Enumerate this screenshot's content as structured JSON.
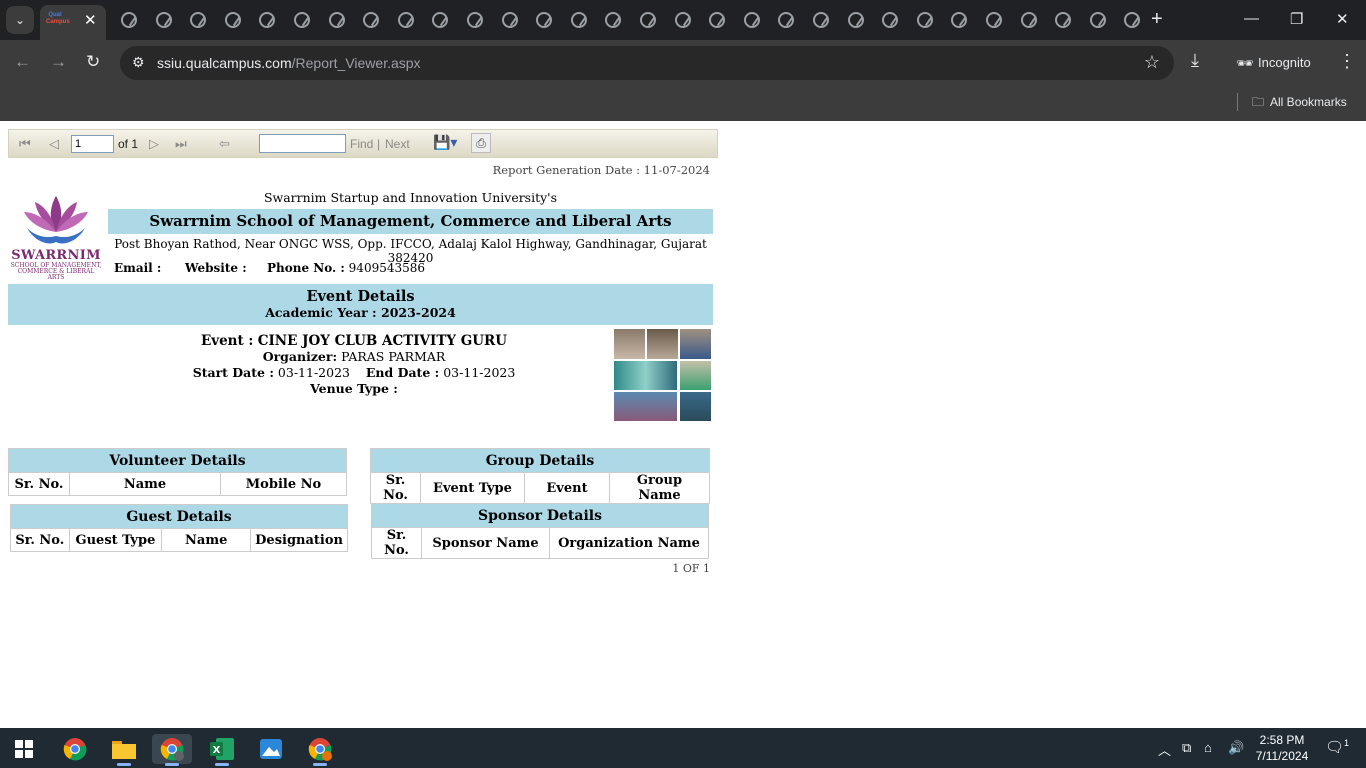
{
  "browser": {
    "tab_favicon_top": "Qual",
    "tab_favicon_bottom": "Campus",
    "url_host": "ssiu.qualcampus.com",
    "url_path": "/Report_Viewer.aspx",
    "incognito_label": "Incognito",
    "bookmarks_label": "All Bookmarks"
  },
  "viewer": {
    "page_value": "1",
    "of_pages": "of 1",
    "find_label": "Find",
    "find_sep": "|",
    "next_label": "Next"
  },
  "report": {
    "generation_date": "Report Generation Date : 11-07-2024",
    "logo_text": "SWARRNIM",
    "logo_sub1": "SCHOOL OF MANAGEMENT,",
    "logo_sub2": "COMMERCE & LIBERAL ARTS",
    "university": "Swarrnim Startup and Innovation University's",
    "school": "Swarrnim School of Management, Commerce and Liberal Arts",
    "address": "Post Bhoyan Rathod, Near ONGC WSS, Opp. IFCCO, Adalaj Kalol Highway, Gandhinagar, Gujarat 382420",
    "email_label": "Email :",
    "website_label": "Website :",
    "phone_label": "Phone No. :",
    "phone_value": "9409543586",
    "event_details_title": "Event Details",
    "academic_year": "Academic Year : 2023-2024",
    "event_label": "Event :",
    "event_name": "CINE JOY CLUB ACTIVITY GURU",
    "organizer_label": "Organizer:",
    "organizer_value": "PARAS PARMAR",
    "start_label": "Start Date :",
    "start_value": "03-11-2023",
    "end_label": "End Date :",
    "end_value": "03-11-2023",
    "venue_label": "Venue Type :",
    "page_footer": "1 OF 1"
  },
  "tables": {
    "volunteer": {
      "title": "Volunteer Details",
      "headers": [
        "Sr. No.",
        "Name",
        "Mobile No"
      ]
    },
    "group": {
      "title": "Group Details",
      "headers": [
        "Sr. No.",
        "Event Type",
        "Event",
        "Group Name"
      ]
    },
    "guest": {
      "title": "Guest Details",
      "headers": [
        "Sr. No.",
        "Guest Type",
        "Name",
        "Designation"
      ]
    },
    "sponsor": {
      "title": "Sponsor Details",
      "headers": [
        "Sr. No.",
        "Sponsor Name",
        "Organization Name"
      ]
    }
  },
  "taskbar": {
    "time": "2:58 PM",
    "date": "7/11/2024",
    "notif_count": "1"
  },
  "colors": {
    "header_blue": "#add8e6",
    "chrome_dark": "#202124",
    "chrome_toolbar": "#3c3c3c",
    "taskbar": "#1f2a33"
  }
}
